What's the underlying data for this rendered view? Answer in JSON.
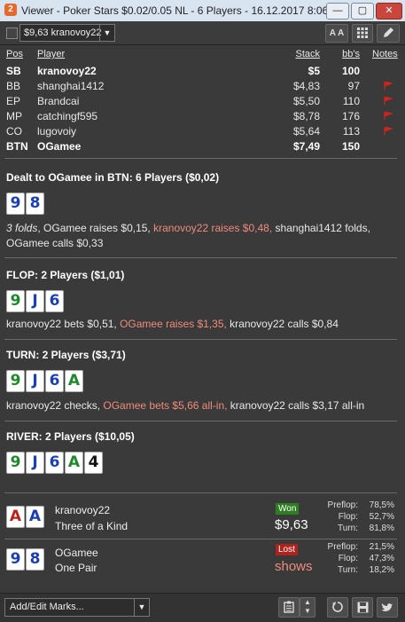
{
  "window": {
    "title": "Viewer - Poker Stars $0.02/0.05 NL - 6 Players - 16.12.2017 8:06",
    "app_icon": "2"
  },
  "toolbar": {
    "hand_select": "$9,63 kranovoy22",
    "font_label": "A A"
  },
  "table": {
    "headers": {
      "pos": "Pos",
      "player": "Player",
      "stack": "Stack",
      "bbs": "bb's",
      "notes": "Notes"
    },
    "rows": [
      {
        "pos": "SB",
        "player": "kranovoy22",
        "stack": "$5",
        "bbs": "100",
        "bold": true,
        "flag": false
      },
      {
        "pos": "BB",
        "player": "shanghai1412",
        "stack": "$4,83",
        "bbs": "97",
        "bold": false,
        "flag": true
      },
      {
        "pos": "EP",
        "player": "Brandcai",
        "stack": "$5,50",
        "bbs": "110",
        "bold": false,
        "flag": true
      },
      {
        "pos": "MP",
        "player": "catchingf595",
        "stack": "$8,78",
        "bbs": "176",
        "bold": false,
        "flag": true
      },
      {
        "pos": "CO",
        "player": "lugovoiy",
        "stack": "$5,64",
        "bbs": "113",
        "bold": false,
        "flag": true
      },
      {
        "pos": "BTN",
        "player": "OGamee",
        "stack": "$7,49",
        "bbs": "150",
        "bold": true,
        "flag": false
      }
    ]
  },
  "preflop": {
    "header": "Dealt to OGamee in BTN: 6 Players ($0,02)",
    "cards": [
      {
        "r": "9",
        "color": "#1a3fb5"
      },
      {
        "r": "8",
        "color": "#1a3fb5"
      }
    ],
    "a1": "3 folds",
    "a2": ", OGamee raises $0,15, ",
    "a3": "kranovoy22 raises $0,48,",
    "a4": " shanghai1412 folds, OGamee calls $0,33"
  },
  "flop": {
    "header": "FLOP: 2 Players ($1,01)",
    "cards": [
      {
        "r": "9",
        "color": "#1c8a2a"
      },
      {
        "r": "J",
        "color": "#1a3fb5"
      },
      {
        "r": "6",
        "color": "#1a3fb5"
      }
    ],
    "a1": "kranovoy22 bets $0,51, ",
    "a2": "OGamee raises $1,35,",
    "a3": " kranovoy22 calls $0,84"
  },
  "turn": {
    "header": "TURN: 2 Players ($3,71)",
    "cards": [
      {
        "r": "9",
        "color": "#1c8a2a"
      },
      {
        "r": "J",
        "color": "#1a3fb5"
      },
      {
        "r": "6",
        "color": "#1a3fb5"
      },
      {
        "r": "A",
        "color": "#1c8a2a"
      }
    ],
    "a1": "kranovoy22 checks, ",
    "a2": "OGamee bets $5,66 all-in,",
    "a3": " kranovoy22 calls $3,17 all-in"
  },
  "river": {
    "header": "RIVER: 2 Players ($10,05)",
    "cards": [
      {
        "r": "9",
        "color": "#1c8a2a"
      },
      {
        "r": "J",
        "color": "#1a3fb5"
      },
      {
        "r": "6",
        "color": "#1a3fb5"
      },
      {
        "r": "A",
        "color": "#1c8a2a"
      },
      {
        "r": "4",
        "color": "#111111"
      }
    ]
  },
  "results": [
    {
      "cards": [
        {
          "r": "A",
          "color": "#c0201a"
        },
        {
          "r": "A",
          "color": "#1a3fb5"
        }
      ],
      "name": "kranovoy22",
      "hand": "Three of a Kind",
      "badge": "Won",
      "badge_color": "#2e7d22",
      "amount": "$9,63",
      "shows": "",
      "preflop": "78,5%",
      "flop": "52,7%",
      "turn": "81,8%"
    },
    {
      "cards": [
        {
          "r": "9",
          "color": "#1a3fb5"
        },
        {
          "r": "8",
          "color": "#1a3fb5"
        }
      ],
      "name": "OGamee",
      "hand": "One Pair",
      "badge": "Lost",
      "badge_color": "#b0221c",
      "amount": "",
      "shows": "shows",
      "preflop": "21,5%",
      "flop": "47,3%",
      "turn": "18,2%"
    }
  ],
  "equity_labels": {
    "preflop": "Preflop:",
    "flop": "Flop:",
    "turn": "Turn:"
  },
  "bottombar": {
    "marks": "Add/Edit Marks..."
  },
  "colors": {
    "accent_red": "#f08b7b",
    "background": "#3a3a3a",
    "flag": "#d1231c"
  }
}
